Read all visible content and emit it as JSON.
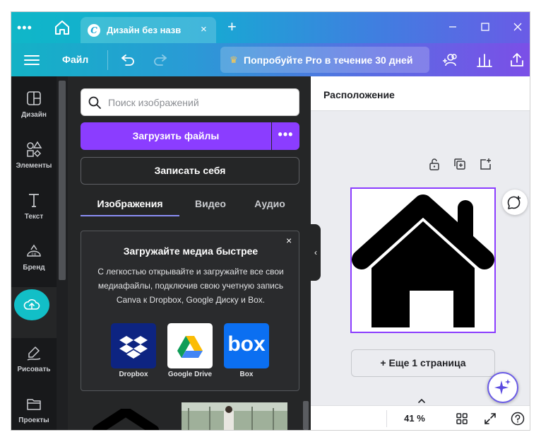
{
  "titlebar": {
    "tab_title": "Дизайн без назв",
    "tab_logo": "C",
    "close_tab": "×",
    "new_tab": "+",
    "window_controls": [
      "minimize-icon",
      "maximize-icon",
      "close-icon"
    ]
  },
  "toolbar": {
    "file_label": "Файл",
    "pro_crown": "♛",
    "pro_label": "Попробуйте Pro в течение 30 дней",
    "icons": [
      "share-people-icon",
      "analytics-icon",
      "export-icon"
    ]
  },
  "rail": {
    "items": [
      {
        "label": "Дизайн",
        "icon": "design-icon"
      },
      {
        "label": "Элементы",
        "icon": "elements-icon"
      },
      {
        "label": "Текст",
        "icon": "text-icon"
      },
      {
        "label": "Бренд",
        "icon": "brand-icon"
      },
      {
        "label": "",
        "icon": "upload-icon"
      },
      {
        "label": "Рисовать",
        "icon": "draw-icon"
      },
      {
        "label": "Проекты",
        "icon": "projects-icon"
      }
    ]
  },
  "panel": {
    "search_placeholder": "Поиск изображений",
    "upload_label": "Загрузить файлы",
    "upload_more": "•••",
    "record_label": "Записать себя",
    "tabs": [
      "Изображения",
      "Видео",
      "Аудио"
    ],
    "promo": {
      "close": "×",
      "title": "Загружайте медиа быстрее",
      "body": "С легкостью открывайте и загружайте все свои медиафайлы, подключив свою учетную запись Canva к Dropbox, Google Диску и Box.",
      "services": [
        "Dropbox",
        "Google Drive",
        "Box"
      ],
      "box_logo_text": "box"
    }
  },
  "canvas": {
    "header_title": "Расположение",
    "add_page_label": "+ Еще 1 страница",
    "zoom": "41 %",
    "collapse_arrow": "‹"
  },
  "colors": {
    "accent": "#8b3dff",
    "upload_active": "#12bfc7",
    "rail_bg": "#18191b",
    "panel_bg": "#252627"
  }
}
